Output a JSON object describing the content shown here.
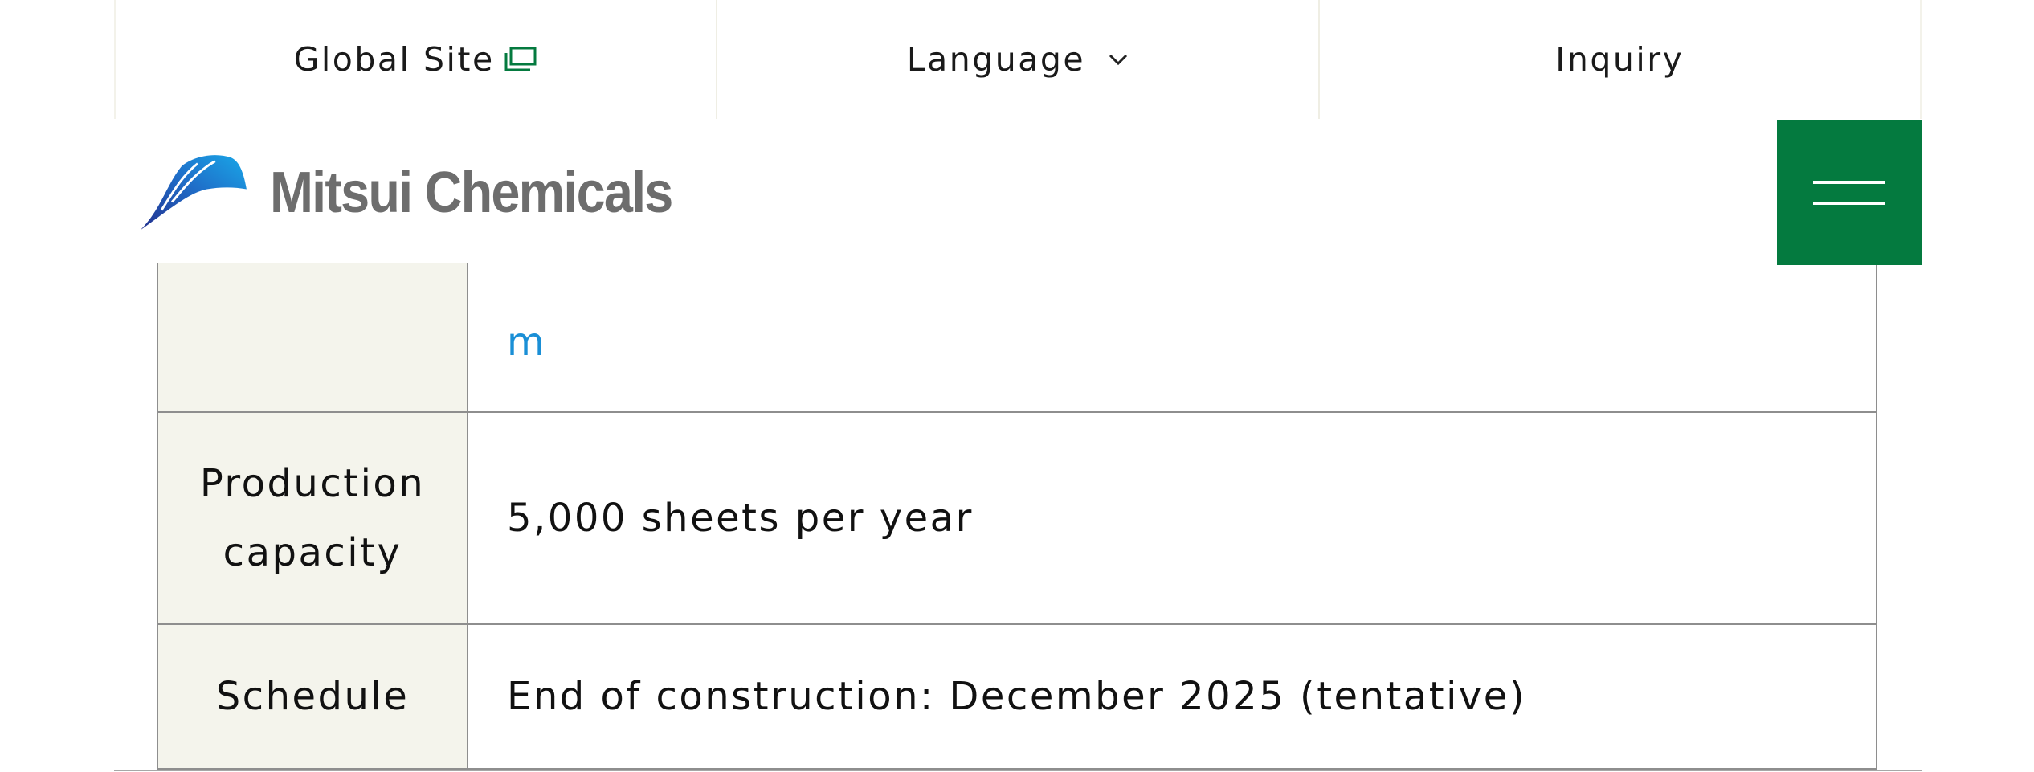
{
  "topbar": {
    "global_site": "Global Site",
    "language": "Language",
    "inquiry": "Inquiry"
  },
  "header": {
    "logo_text": "Mitsui Chemicals",
    "menu_icon": "hamburger-menu-icon"
  },
  "table": {
    "partial_row": {
      "header": "",
      "value": "m"
    },
    "rows": [
      {
        "header_line1": "Production",
        "header_line2": "capacity",
        "value": "5,000 sheets per year"
      },
      {
        "header": "Schedule",
        "value": "End of construction: December 2025 (tentative)"
      }
    ]
  },
  "icons": {
    "external_link": "external-window-icon",
    "chevron": "chevron-down-icon",
    "logo_mark": "mitsui-wing-logo-icon"
  },
  "colors": {
    "brand_green": "#047a3f",
    "link_blue": "#1a8fd6",
    "table_header_bg": "#f4f4ec",
    "logo_gray": "#6d6d6d"
  }
}
